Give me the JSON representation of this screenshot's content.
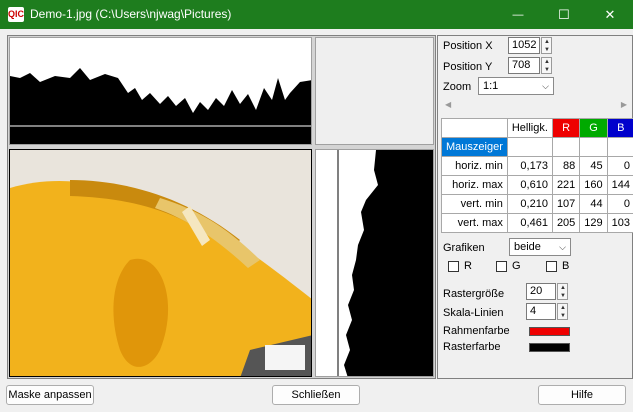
{
  "window": {
    "title": "Demo-1.jpg  (C:\\Users\\njwag\\Pictures)",
    "icon_text": "QIC",
    "minimize": "—",
    "maximize": "☐",
    "close": "✕"
  },
  "position": {
    "x_label": "Position X",
    "x_value": "1052",
    "y_label": "Position Y",
    "y_value": "708"
  },
  "zoom": {
    "label": "Zoom",
    "value": "1:1"
  },
  "table": {
    "headers": [
      "",
      "Helligk.",
      "R",
      "G",
      "B"
    ],
    "header_colors": {
      "R": "#ee0000",
      "G": "#00aa00",
      "B": "#0000cc"
    },
    "highlight_row": "Mauszeiger",
    "highlight_color": "#0078d7",
    "rows": [
      {
        "label": "horiz. min",
        "h": "0,173",
        "r": "88",
        "g": "45",
        "b": "0"
      },
      {
        "label": "horiz. max",
        "h": "0,610",
        "r": "221",
        "g": "160",
        "b": "144"
      },
      {
        "label": "vert. min",
        "h": "0,210",
        "r": "107",
        "g": "44",
        "b": "0"
      },
      {
        "label": "vert. max",
        "h": "0,461",
        "r": "205",
        "g": "129",
        "b": "103"
      }
    ]
  },
  "graphics": {
    "label": "Grafiken",
    "value": "beide",
    "r": "R",
    "g": "G",
    "b": "B"
  },
  "raster": {
    "size_label": "Rastergröße",
    "size_value": "20",
    "lines_label": "Skala-Linien",
    "lines_value": "4"
  },
  "colors": {
    "frame_label": "Rahmenfarbe",
    "frame_color": "#ee0000",
    "raster_label": "Rasterfarbe",
    "raster_color": "#000000"
  },
  "buttons": {
    "mask": "Maske anpassen",
    "close": "Schließen",
    "help": "Hilfe"
  },
  "icons": {
    "scroll_left": "◀",
    "scroll_right": "▶",
    "dropdown": "⌵",
    "up": "▲",
    "down": "▼"
  },
  "theme": {
    "titlebar": "#1e7d1e",
    "image_yellow": "#f2b21c"
  }
}
